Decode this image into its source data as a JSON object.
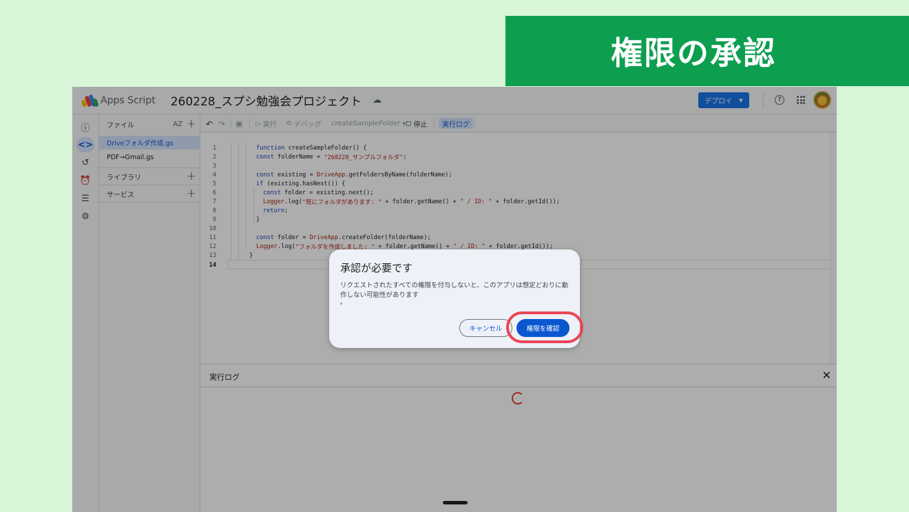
{
  "banner": {
    "title": "権限の承認"
  },
  "header": {
    "app_name": "Apps Script",
    "project_title": "260228_スプシ勉強会プロジェクト",
    "deploy_label": "デプロイ",
    "help_glyph": "?"
  },
  "file_panel": {
    "files_heading": "ファイル",
    "sort_label": "AZ",
    "files": [
      "Driveフォルダ作成.gs",
      "PDF→Gmail.gs"
    ],
    "libraries_heading": "ライブラリ",
    "services_heading": "サービス"
  },
  "toolbar": {
    "run_label": "実行",
    "debug_label": "デバッグ",
    "function_name": "createSampleFolder",
    "stop_label": "停止",
    "log_label": "実行ログ"
  },
  "code": {
    "line_numbers": [
      "1",
      "2",
      "3",
      "4",
      "5",
      "6",
      "7",
      "8",
      "9",
      "10",
      "11",
      "12",
      "13",
      "14"
    ],
    "l1a": "function ",
    "l1b": "createSampleFolder() {",
    "l2a": "const ",
    "l2b": "folderName = ",
    "l2c": "\"260228_サンプルフォルダ\"",
    "l2d": ";",
    "l4a": "const ",
    "l4b": "existing = ",
    "l4c": "DriveApp",
    "l4d": ".getFoldersByName(folderName);",
    "l5a": "if ",
    "l5b": "(existing.hasNext()) {",
    "l6a": "const ",
    "l6b": "folder = existing.next();",
    "l7a": "Logger",
    "l7b": ".log(",
    "l7c": "\"既にフォルダがあります: \"",
    "l7d": " + folder.getName() + ",
    "l7e": "\" / ID: \"",
    "l7f": " + folder.getId());",
    "l8a": "return",
    "l8b": ";",
    "l9a": "}",
    "l11a": "const ",
    "l11b": "folder = ",
    "l11c": "DriveApp",
    "l11d": ".createFolder(folderName);",
    "l12a": "Logger",
    "l12b": ".log(",
    "l12c": "\"フォルダを作成しました: \"",
    "l12d": " + folder.getName() + ",
    "l12e": "\" / ID: \"",
    "l12f": " + folder.getId());",
    "l13a": "}"
  },
  "log_panel": {
    "title": "実行ログ",
    "close_glyph": "✕"
  },
  "dialog": {
    "title": "承認が必要です",
    "body": "リクエストされたすべての権限を付与しないと、このアプリは想定どおりに動作しない可能性があります",
    "cancel_label": "キャンセル",
    "confirm_label": "権限を確認"
  },
  "colors": {
    "accent": "#0b57d0",
    "banner": "#0d9e50",
    "highlight": "#ea4656"
  }
}
